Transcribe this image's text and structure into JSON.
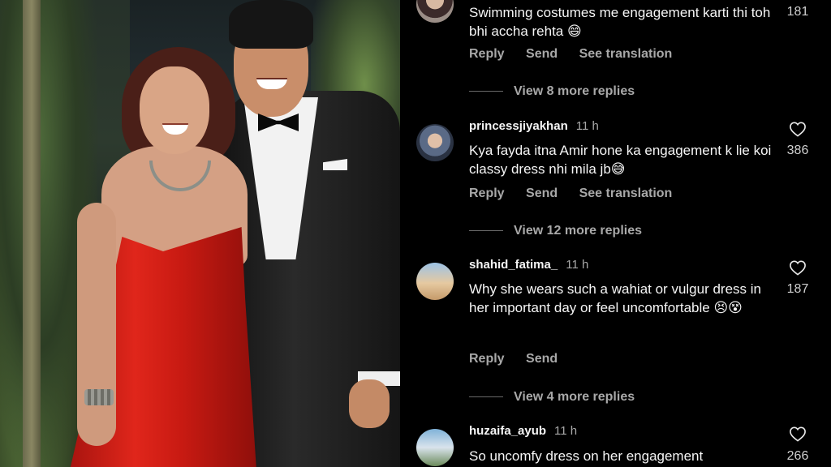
{
  "comments": [
    {
      "username": "",
      "time": "",
      "text": "Swimming costumes me engagement karti thi toh bhi accha rehta",
      "emoji": "😄",
      "likes": "181",
      "reply": "Reply",
      "send": "Send",
      "translate": "See translation",
      "view_more": "View 8 more replies"
    },
    {
      "username": "princessjiyakhan",
      "time": "11 h",
      "text": "Kya fayda itna Amir hone ka engagement k lie koi classy dress nhi mila jb",
      "emoji": "😅",
      "likes": "386",
      "reply": "Reply",
      "send": "Send",
      "translate": "See translation",
      "view_more": "View 12 more replies"
    },
    {
      "username": "shahid_fatima_",
      "time": "11 h",
      "text": "Why she wears such a wahiat or vulgur dress in her important day or feel uncomfortable",
      "emoji": "😣😵",
      "likes": "187",
      "reply": "Reply",
      "send": "Send",
      "view_more": "View 4 more replies"
    },
    {
      "username": "huzaifa_ayub",
      "time": "11 h",
      "text": "So uncomfy dress on her engagement",
      "likes": "266"
    }
  ],
  "icons": {
    "like": "heart-outline-icon"
  },
  "colors": {
    "background": "#000000",
    "text": "#f5f5f5",
    "muted": "#a8a8a8"
  }
}
